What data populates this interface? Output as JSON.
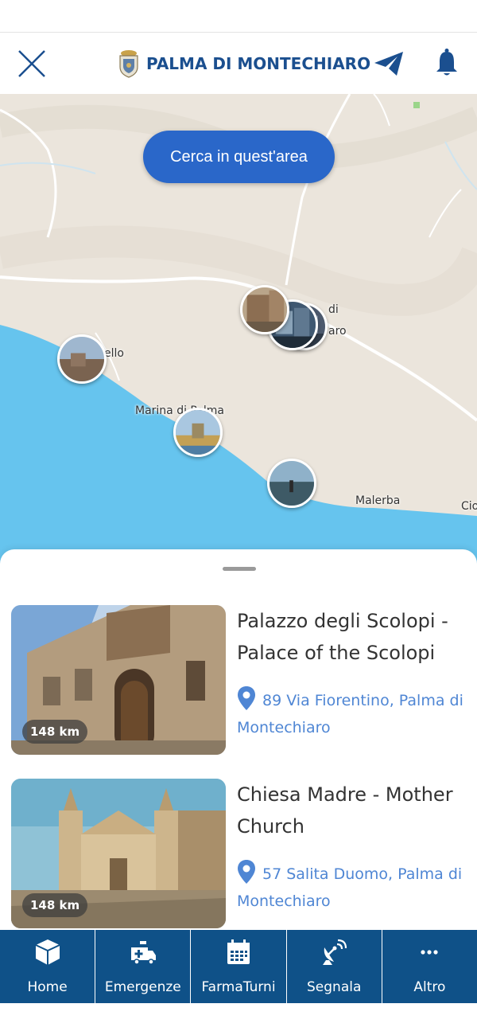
{
  "header": {
    "brand_name": "PALMA DI MONTECHIARO",
    "accent_color": "#1b4f8f"
  },
  "map": {
    "search_area_label": "Cerca in quest'area",
    "labels": {
      "town_a": "di",
      "town_b": "aro",
      "ello": "ello",
      "marina": "Marina di Palma",
      "malerba": "Malerba",
      "cio": "Cio"
    }
  },
  "places": [
    {
      "title": "Palazzo degli Scolopi - Palace of the Scolopi",
      "address": "89 Via Fiorentino, Palma di Montechiaro",
      "distance": "148 km"
    },
    {
      "title": "Chiesa Madre - Mother Church",
      "address": "57 Salita Duomo, Palma di Montechiaro",
      "distance": "148 km"
    }
  ],
  "tabbar": {
    "items": [
      {
        "label": "Home",
        "icon": "box-icon"
      },
      {
        "label": "Emergenze",
        "icon": "ambulance-icon"
      },
      {
        "label": "FarmaTurni",
        "icon": "calendar-icon"
      },
      {
        "label": "Segnala",
        "icon": "satellite-dish-icon"
      },
      {
        "label": "Altro",
        "icon": "more-dots-icon"
      }
    ],
    "background": "#0f5188"
  }
}
